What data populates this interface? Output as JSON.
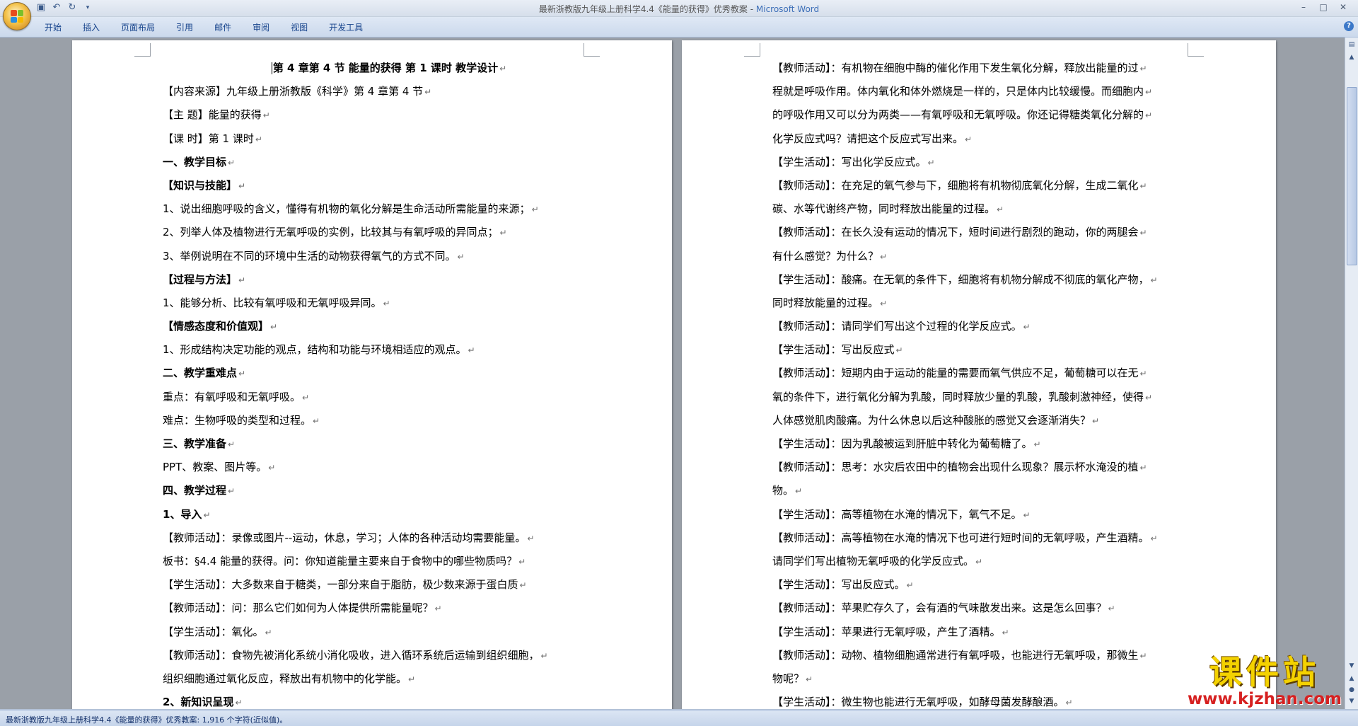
{
  "window": {
    "title": "最新浙教版九年级上册科学4.4《能量的获得》优秀教案 - ",
    "app_name": "Microsoft Word",
    "controls": [
      "–",
      "□",
      "✕"
    ]
  },
  "ribbon": {
    "tabs": [
      "开始",
      "插入",
      "页面布局",
      "引用",
      "邮件",
      "审阅",
      "视图",
      "开发工具"
    ],
    "help": "?"
  },
  "document": {
    "left_page": [
      {
        "text": "第 4 章第 4 节  能量的获得  第 1 课时  教学设计",
        "style": "title"
      },
      {
        "text": "【内容来源】九年级上册浙教版《科学》第 4 章第 4 节",
        "style": "normal"
      },
      {
        "text": "【主       题】能量的获得",
        "style": "normal"
      },
      {
        "text": "【课       时】第 1 课时",
        "style": "normal"
      },
      {
        "text": "一、教学目标",
        "style": "bold"
      },
      {
        "text": "【知识与技能】",
        "style": "bold"
      },
      {
        "text": "1、说出细胞呼吸的含义，懂得有机物的氧化分解是生命活动所需能量的来源；",
        "style": "normal"
      },
      {
        "text": "2、列举人体及植物进行无氧呼吸的实例，比较其与有氧呼吸的异同点；",
        "style": "normal"
      },
      {
        "text": "3、举例说明在不同的环境中生活的动物获得氧气的方式不同。",
        "style": "normal"
      },
      {
        "text": "【过程与方法】",
        "style": "bold"
      },
      {
        "text": "1、能够分析、比较有氧呼吸和无氧呼吸异同。",
        "style": "normal"
      },
      {
        "text": "【情感态度和价值观】",
        "style": "bold"
      },
      {
        "text": "1、形成结构决定功能的观点，结构和功能与环境相适应的观点。",
        "style": "normal"
      },
      {
        "text": "二、教学重难点",
        "style": "bold"
      },
      {
        "text": "重点：有氧呼吸和无氧呼吸。",
        "style": "normal"
      },
      {
        "text": "难点：生物呼吸的类型和过程。",
        "style": "normal"
      },
      {
        "text": "三、教学准备",
        "style": "bold"
      },
      {
        "text": "PPT、教案、图片等。",
        "style": "normal"
      },
      {
        "text": "四、教学过程",
        "style": "bold"
      },
      {
        "text": "1、导入",
        "style": "bold"
      },
      {
        "text": "【教师活动】：录像或图片--运动，休息，学习；人体的各种活动均需要能量。",
        "style": "normal"
      },
      {
        "text": "板书：§4.4 能量的获得。问：你知道能量主要来自于食物中的哪些物质吗？",
        "style": "normal"
      },
      {
        "text": "【学生活动】：大多数来自于糖类，一部分来自于脂肪，极少数来源于蛋白质",
        "style": "normal"
      },
      {
        "text": "【教师活动】：问：那么它们如何为人体提供所需能量呢？",
        "style": "normal"
      },
      {
        "text": "【学生活动】：氧化。",
        "style": "normal"
      },
      {
        "text": "【教师活动】：食物先被消化系统小消化吸收，进入循环系统后运输到组织细胞，",
        "style": "normal"
      },
      {
        "text": "组织细胞通过氧化反应，释放出有机物中的化学能。",
        "style": "normal"
      },
      {
        "text": "2、新知识呈现",
        "style": "bold"
      }
    ],
    "right_page": [
      {
        "text": "【教师活动】：有机物在细胞中酶的催化作用下发生氧化分解，释放出能量的过",
        "style": "normal"
      },
      {
        "text": "程就是呼吸作用。体内氧化和体外燃烧是一样的，只是体内比较缓慢。而细胞内",
        "style": "normal"
      },
      {
        "text": "的呼吸作用又可以分为两类——有氧呼吸和无氧呼吸。你还记得糖类氧化分解的",
        "style": "normal"
      },
      {
        "text": "化学反应式吗？请把这个反应式写出来。",
        "style": "normal"
      },
      {
        "text": "【学生活动】：写出化学反应式。",
        "style": "normal"
      },
      {
        "text": "【教师活动】：在充足的氧气参与下，细胞将有机物彻底氧化分解，生成二氧化",
        "style": "normal"
      },
      {
        "text": "碳、水等代谢终产物，同时释放出能量的过程。",
        "style": "normal"
      },
      {
        "text": "【教师活动】：在长久没有运动的情况下，短时间进行剧烈的跑动，你的两腿会",
        "style": "normal"
      },
      {
        "text": "有什么感觉？为什么？",
        "style": "normal"
      },
      {
        "text": "【学生活动】：酸痛。在无氧的条件下，细胞将有机物分解成不彻底的氧化产物，",
        "style": "normal"
      },
      {
        "text": "同时释放能量的过程。",
        "style": "normal"
      },
      {
        "text": "【教师活动】：请同学们写出这个过程的化学反应式。",
        "style": "normal"
      },
      {
        "text": "【学生活动】：写出反应式",
        "style": "normal"
      },
      {
        "text": "【教师活动】：短期内由于运动的能量的需要而氧气供应不足，葡萄糖可以在无",
        "style": "normal"
      },
      {
        "text": "氧的条件下，进行氧化分解为乳酸，同时释放少量的乳酸，乳酸刺激神经，使得",
        "style": "normal"
      },
      {
        "text": "人体感觉肌肉酸痛。为什么休息以后这种酸胀的感觉又会逐渐消失？",
        "style": "normal"
      },
      {
        "text": "【学生活动】：因为乳酸被运到肝脏中转化为葡萄糖了。",
        "style": "normal"
      },
      {
        "text": "【教师活动】：思考：水灾后农田中的植物会出现什么现象？展示杯水淹没的植",
        "style": "normal"
      },
      {
        "text": "物。",
        "style": "normal"
      },
      {
        "text": "【学生活动】：高等植物在水淹的情况下，氧气不足。",
        "style": "normal"
      },
      {
        "text": "【教师活动】：高等植物在水淹的情况下也可进行短时间的无氧呼吸，产生酒精。",
        "style": "normal"
      },
      {
        "text": "请同学们写出植物无氧呼吸的化学反应式。",
        "style": "normal"
      },
      {
        "text": "【学生活动】：写出反应式。",
        "style": "normal"
      },
      {
        "text": "【教师活动】：苹果贮存久了，会有酒的气味散发出来。这是怎么回事？",
        "style": "normal"
      },
      {
        "text": "【学生活动】：苹果进行无氧呼吸，产生了酒精。",
        "style": "normal"
      },
      {
        "text": "【教师活动】：动物、植物细胞通常进行有氧呼吸，也能进行无氧呼吸，那微生",
        "style": "normal"
      },
      {
        "text": "物呢？",
        "style": "normal"
      },
      {
        "text": "【学生活动】：微生物也能进行无氧呼吸，如酵母菌发酵酿酒。",
        "style": "normal"
      }
    ]
  },
  "status_bar": {
    "text": "最新浙教版九年级上册科学4.4《能量的获得》优秀教案: 1,916 个字符(近似值)。"
  },
  "watermark": {
    "text_cn": "课件站",
    "url": "www.kjzhan.com"
  },
  "colors": {
    "office_logo": [
      "#e84c1d",
      "#7cbf2a",
      "#2a8ee0",
      "#f5b800"
    ]
  }
}
